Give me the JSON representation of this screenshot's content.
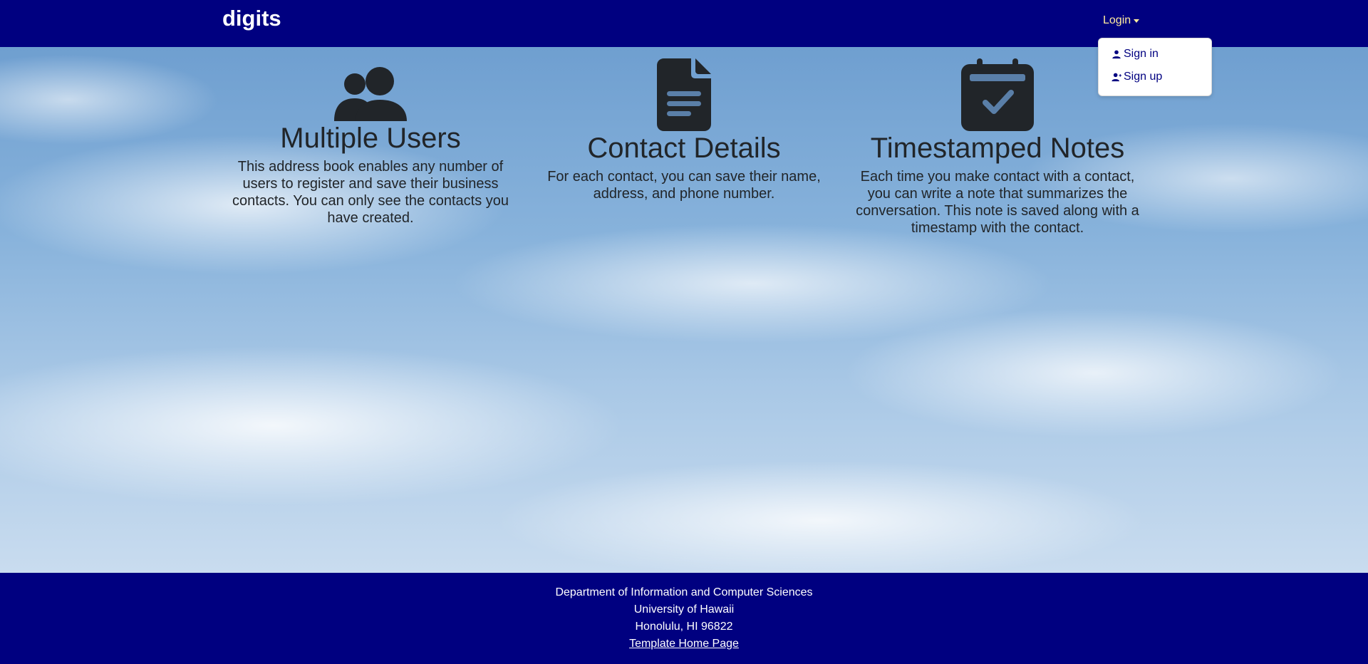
{
  "navbar": {
    "brand": "digits",
    "login_label": "Login",
    "background": "#000080",
    "login_color": "#ffec9e"
  },
  "dropdown": {
    "items": [
      {
        "label": "Sign in",
        "icon": "person-icon"
      },
      {
        "label": "Sign up",
        "icon": "person-add-icon"
      }
    ]
  },
  "features": [
    {
      "icon": "people-icon",
      "title": "Multiple Users",
      "description": "This address book enables any number of users to register and save their business contacts. You can only see the contacts you have created."
    },
    {
      "icon": "document-icon",
      "title": "Contact Details",
      "description": "For each contact, you can save their name, address, and phone number."
    },
    {
      "icon": "calendar-check-icon",
      "title": "Timestamped Notes",
      "description": "Each time you make contact with a contact, you can write a note that summarizes the conversation. This note is saved along with a timestamp with the contact."
    }
  ],
  "footer": {
    "line1": "Department of Information and Computer Sciences",
    "line2": "University of Hawaii",
    "line3": "Honolulu, HI 96822",
    "link_label": "Template Home Page",
    "background": "#000080"
  }
}
